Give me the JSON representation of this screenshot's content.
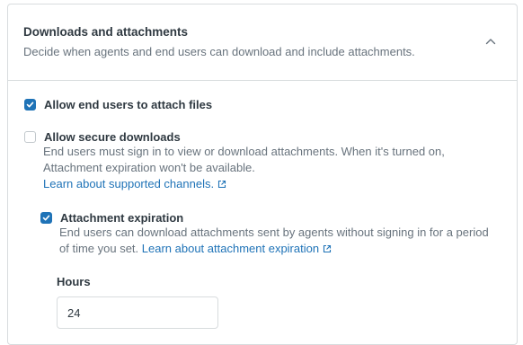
{
  "section": {
    "title": "Downloads and attachments",
    "description": "Decide when agents and end users can download and include attachments.",
    "collapse_icon": "chevron-up-icon"
  },
  "options": {
    "attach_files": {
      "label": "Allow end users to attach files",
      "checked": true
    },
    "secure_downloads": {
      "label": "Allow secure downloads",
      "checked": false,
      "hint_line1": "End users must sign in to view or download attachments. When it's turned on,",
      "hint_line2": "Attachment expiration won't be available.",
      "link": "Learn about supported channels."
    },
    "attachment_expiration": {
      "label": "Attachment expiration",
      "checked": true,
      "hint_line1": "End users can download attachments sent by agents without signing in for a period",
      "hint_line2": "of time you set.",
      "link": "Learn about attachment expiration"
    }
  },
  "hours": {
    "label": "Hours",
    "value": "24"
  },
  "colors": {
    "accent": "#1f73b7",
    "text": "#2f3941",
    "muted": "#68737d",
    "border": "#d8dcde"
  },
  "icons": {
    "check": "check-icon",
    "external_link": "external-link-icon"
  }
}
